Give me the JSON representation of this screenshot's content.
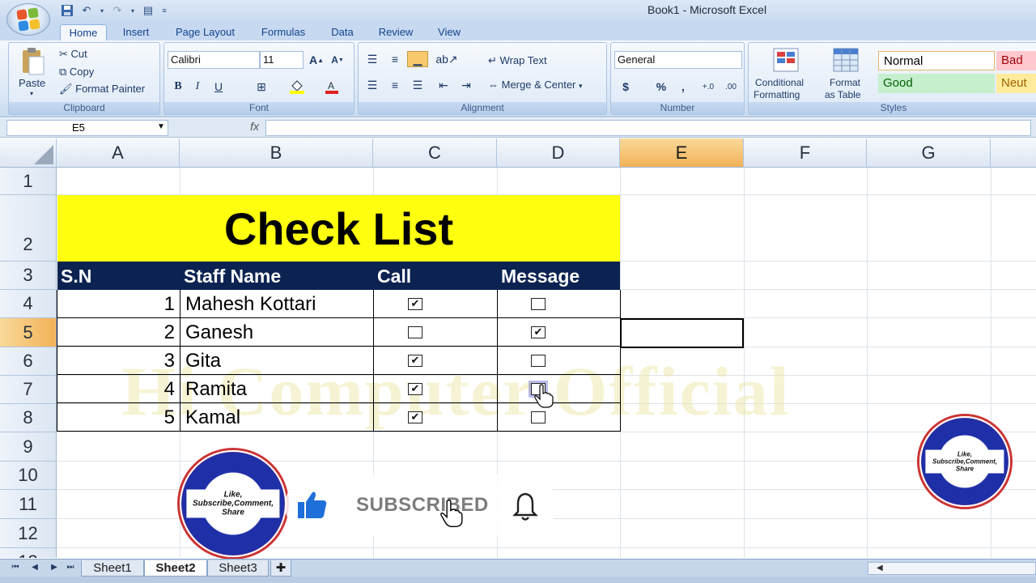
{
  "window": {
    "title": "Book1 - Microsoft Excel"
  },
  "tabs": [
    "Home",
    "Insert",
    "Page Layout",
    "Formulas",
    "Data",
    "Review",
    "View"
  ],
  "ribbon": {
    "clipboard": {
      "label": "Clipboard",
      "paste": "Paste",
      "cut": "Cut",
      "copy": "Copy",
      "format_painter": "Format Painter"
    },
    "font": {
      "label": "Font",
      "font_name": "Calibri",
      "font_size": "11"
    },
    "alignment": {
      "label": "Alignment",
      "wrap_text": "Wrap Text",
      "merge_center": "Merge & Center"
    },
    "number": {
      "label": "Number",
      "format": "General"
    },
    "styles": {
      "label": "Styles",
      "conditional_line1": "Conditional",
      "conditional_line2": "Formatting",
      "format_table_line1": "Format",
      "format_table_line2": "as Table",
      "normal": "Normal",
      "bad": "Bad",
      "good": "Good",
      "neutral": "Neut"
    }
  },
  "formula_bar": {
    "name_box": "E5",
    "fx": "fx",
    "value": ""
  },
  "columns": [
    "A",
    "B",
    "C",
    "D",
    "E",
    "F",
    "G"
  ],
  "selected_column": "E",
  "rows": [
    "1",
    "2",
    "3",
    "4",
    "5",
    "6",
    "7",
    "8",
    "9",
    "10",
    "11",
    "12",
    "13"
  ],
  "selected_row": "5",
  "sheet": {
    "title": "Check List",
    "headers": [
      "S.N",
      "Staff Name",
      "Call",
      "Message"
    ],
    "records": [
      {
        "sn": "1",
        "name": "Mahesh Kottari",
        "call": true,
        "message": false
      },
      {
        "sn": "2",
        "name": "Ganesh",
        "call": false,
        "message": true
      },
      {
        "sn": "3",
        "name": "Gita",
        "call": true,
        "message": false
      },
      {
        "sn": "4",
        "name": "Ramita",
        "call": true,
        "message": false
      },
      {
        "sn": "5",
        "name": "Kamal",
        "call": true,
        "message": false
      }
    ]
  },
  "watermark": "Hi Computer Official",
  "overlay": {
    "subscribed": "SUBSCRIBED",
    "seal_text": "Like, Subscribe,Comment, Share",
    "seal_name": "Hi Computer Official"
  },
  "sheet_tabs": [
    "Sheet1",
    "Sheet2",
    "Sheet3"
  ],
  "active_sheet": "Sheet2",
  "colors": {
    "title_fill": "#ffff0f",
    "header_fill": "#0c2352",
    "selection": "#f2b257"
  }
}
